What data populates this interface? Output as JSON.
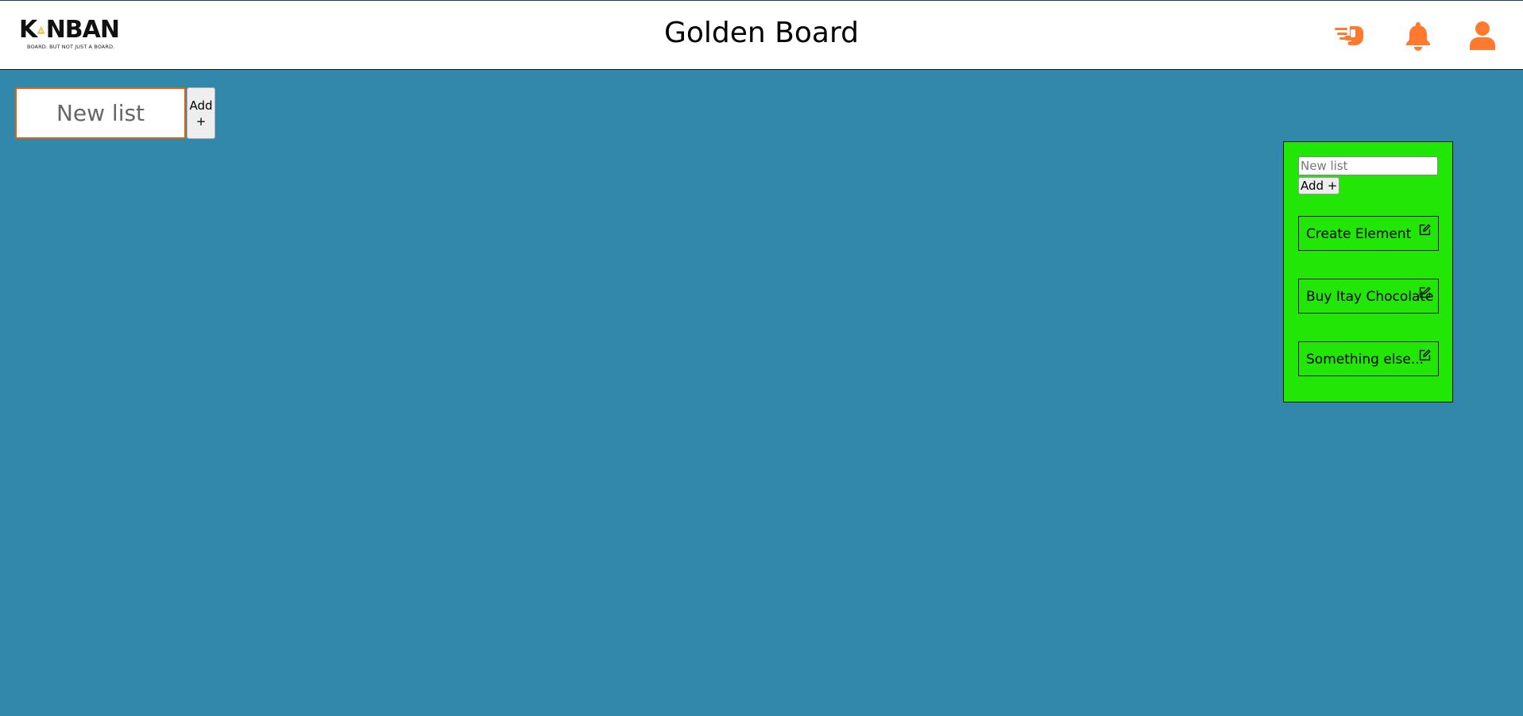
{
  "header": {
    "logo_text_left": "K",
    "logo_text_right": "NBAN",
    "logo_tagline": "BOARD. BUT NOT JUST A BOARD.",
    "title": "Golden Board",
    "icons": [
      "pointing-hand-icon",
      "bell-icon",
      "user-icon"
    ],
    "icon_color": "#ff7a2f"
  },
  "toolbar": {
    "new_list_placeholder": "New list",
    "add_label": "Add +"
  },
  "list": {
    "input_placeholder": "New list",
    "add_label": "Add +",
    "cards": [
      {
        "label": "Create Element"
      },
      {
        "label": "Buy Itay Chocolate"
      },
      {
        "label": "Something else..."
      }
    ]
  },
  "colors": {
    "board_background": "#3288ab",
    "list_background": "#22e605",
    "accent": "#ff7a2f",
    "logo_accent": "#f5a81c"
  }
}
